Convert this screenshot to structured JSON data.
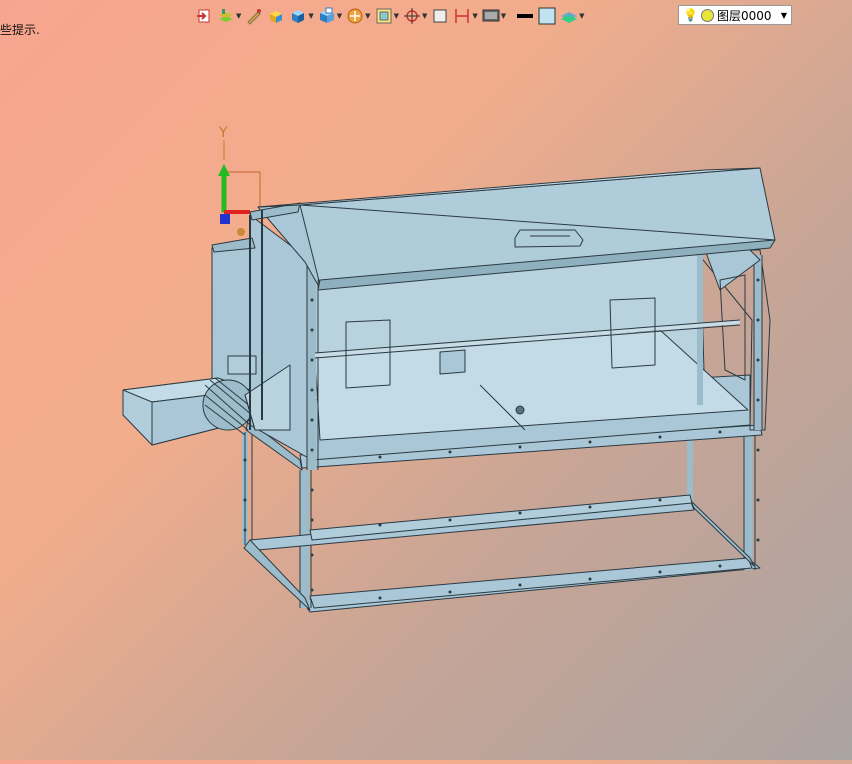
{
  "hint": {
    "text": "些提示."
  },
  "toolbar": {
    "buttons": [
      {
        "icon": "exit-icon"
      },
      {
        "icon": "layers-icon",
        "dropdown": true
      },
      {
        "icon": "pencil-icon"
      },
      {
        "icon": "box-icon"
      },
      {
        "icon": "cube-icon",
        "dropdown": true
      },
      {
        "icon": "view-icon",
        "dropdown": true
      },
      {
        "icon": "render-icon",
        "dropdown": true
      },
      {
        "icon": "frame-icon",
        "dropdown": true
      },
      {
        "icon": "snap-icon",
        "dropdown": true
      },
      {
        "icon": "square-icon"
      },
      {
        "icon": "dimension-icon",
        "dropdown": true
      },
      {
        "icon": "display-icon",
        "dropdown": true
      },
      {
        "icon": "line-color-icon"
      },
      {
        "icon": "fill-color-icon"
      },
      {
        "icon": "layer-stack-icon",
        "dropdown": true
      }
    ],
    "layer": {
      "label": "图层0000"
    }
  },
  "colors": {
    "model_fill": "#a9c7d6",
    "model_dark": "#7fa2b3",
    "model_edge": "#2b3a42"
  },
  "axis": {
    "y_label": "Y"
  }
}
